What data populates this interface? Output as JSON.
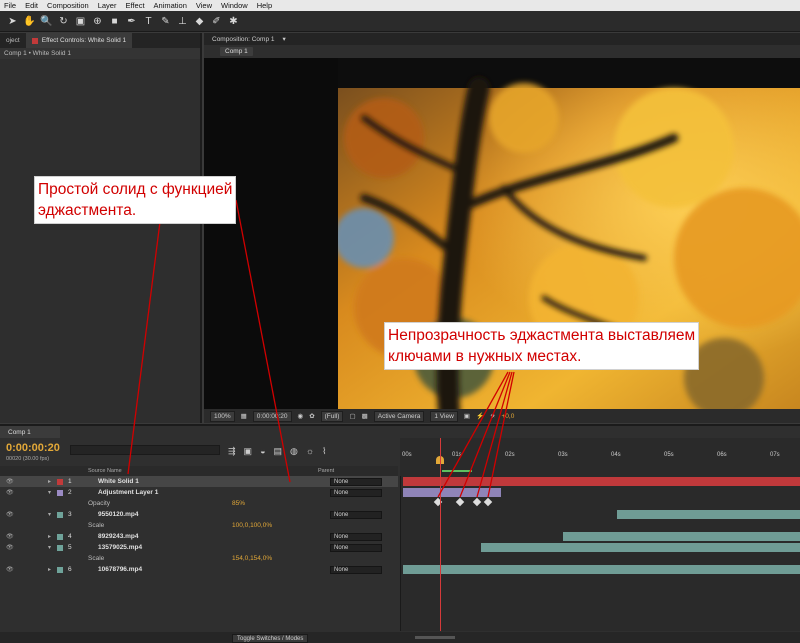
{
  "menu": [
    "File",
    "Edit",
    "Composition",
    "Layer",
    "Effect",
    "Animation",
    "View",
    "Window",
    "Help"
  ],
  "left_panel": {
    "tab_project": "oject",
    "tab_effect": "Effect Controls: White Solid 1",
    "breadcrumb": "Comp 1 • White Solid 1"
  },
  "composition": {
    "tab": "Composition: Comp 1",
    "chip": "Comp 1",
    "footer": {
      "zoom": "100%",
      "timecode": "0:00:00:20",
      "quality": "(Full)",
      "camera": "Active Camera",
      "view": "1 View",
      "exposure": "+0,0"
    }
  },
  "timeline": {
    "tab": "Comp 1",
    "timecode": "0:00:00:20",
    "fps": "00020 (30.00 fps)",
    "col_source": "Source Name",
    "col_parent": "Parent",
    "ruler_ticks": [
      "00s",
      "01s",
      "02s",
      "03s",
      "04s",
      "05s",
      "06s",
      "07s"
    ],
    "layers": [
      {
        "num": "1",
        "name": "White Solid 1",
        "parent": "None",
        "color": "#c23a3a"
      },
      {
        "num": "2",
        "name": "Adjustment Layer 1",
        "parent": "None",
        "color": "#9b8bc4"
      },
      {
        "prop": "Opacity",
        "value": "85%"
      },
      {
        "num": "3",
        "name": "9550120.mp4",
        "parent": "None",
        "color": "#6fa39a"
      },
      {
        "prop": "Scale",
        "value": "100,0,100,0%"
      },
      {
        "num": "4",
        "name": "8929243.mp4",
        "parent": "None",
        "color": "#6fa39a"
      },
      {
        "num": "5",
        "name": "13579025.mp4",
        "parent": "None",
        "color": "#6fa39a"
      },
      {
        "prop": "Scale",
        "value": "154,0,154,0%"
      },
      {
        "num": "6",
        "name": "10678796.mp4",
        "parent": "None",
        "color": "#6fa39a"
      }
    ],
    "toggle_label": "Toggle Switches / Modes"
  },
  "annotations": {
    "note1_line1": "Простой солид с функцией",
    "note1_line2": "эджастмента.",
    "note2_line1": "Непрозрачность эджастмента выставляем",
    "note2_line2": "ключами в нужных местах."
  },
  "colors": {
    "timecode": "#e2a838",
    "annotation": "#d10000",
    "solid_bar": "#c0393b",
    "adjustment_bar": "#8f84b8",
    "footage_bar": "#6f9c95"
  }
}
